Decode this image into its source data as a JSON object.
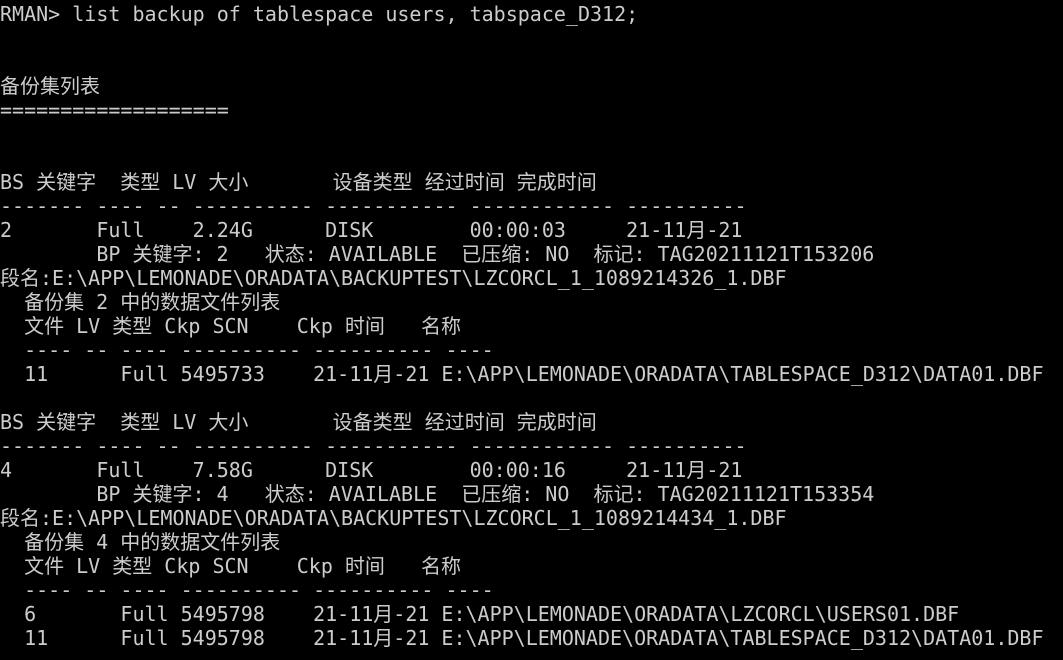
{
  "terminal": {
    "lines": [
      "RMAN> list backup of tablespace users, tabspace_D312;",
      "",
      "",
      "备份集列表",
      "===================",
      "",
      "",
      "BS 关键字  类型 LV 大小       设备类型 经过时间 完成时间",
      "------- ---- -- ---------- ----------- ------------ ----------",
      "2       Full    2.24G      DISK        00:00:03     21-11月-21",
      "        BP 关键字: 2   状态: AVAILABLE  已压缩: NO  标记: TAG20211121T153206",
      "段名:E:\\APP\\LEMONADE\\ORADATA\\BACKUPTEST\\LZCORCL_1_1089214326_1.DBF",
      "  备份集 2 中的数据文件列表",
      "  文件 LV 类型 Ckp SCN    Ckp 时间   名称",
      "  ---- -- ---- ---------- ---------- ----",
      "  11      Full 5495733    21-11月-21 E:\\APP\\LEMONADE\\ORADATA\\TABLESPACE_D312\\DATA01.DBF",
      "",
      "BS 关键字  类型 LV 大小       设备类型 经过时间 完成时间",
      "------- ---- -- ---------- ----------- ------------ ----------",
      "4       Full    7.58G      DISK        00:00:16     21-11月-21",
      "        BP 关键字: 4   状态: AVAILABLE  已压缩: NO  标记: TAG20211121T153354",
      "段名:E:\\APP\\LEMONADE\\ORADATA\\BACKUPTEST\\LZCORCL_1_1089214434_1.DBF",
      "  备份集 4 中的数据文件列表",
      "  文件 LV 类型 Ckp SCN    Ckp 时间   名称",
      "  ---- -- ---- ---------- ---------- ----",
      "  6       Full 5495798    21-11月-21 E:\\APP\\LEMONADE\\ORADATA\\LZCORCL\\USERS01.DBF",
      "  11      Full 5495798    21-11月-21 E:\\APP\\LEMONADE\\ORADATA\\TABLESPACE_D312\\DATA01.DBF"
    ]
  }
}
